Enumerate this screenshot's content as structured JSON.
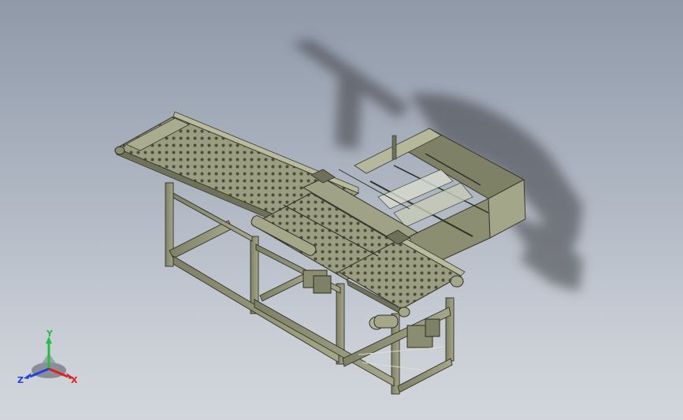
{
  "viewport": {
    "background_top": "#8f99a8",
    "background_bottom": "#d2d6dc",
    "model_color": "#8a8d6f",
    "shadow_color": "#3c3e42"
  },
  "triad": {
    "x_label": "X",
    "y_label": "Y",
    "z_label": "Z",
    "x_color": "#e02020",
    "y_color": "#20c040",
    "z_color": "#2040e0"
  }
}
